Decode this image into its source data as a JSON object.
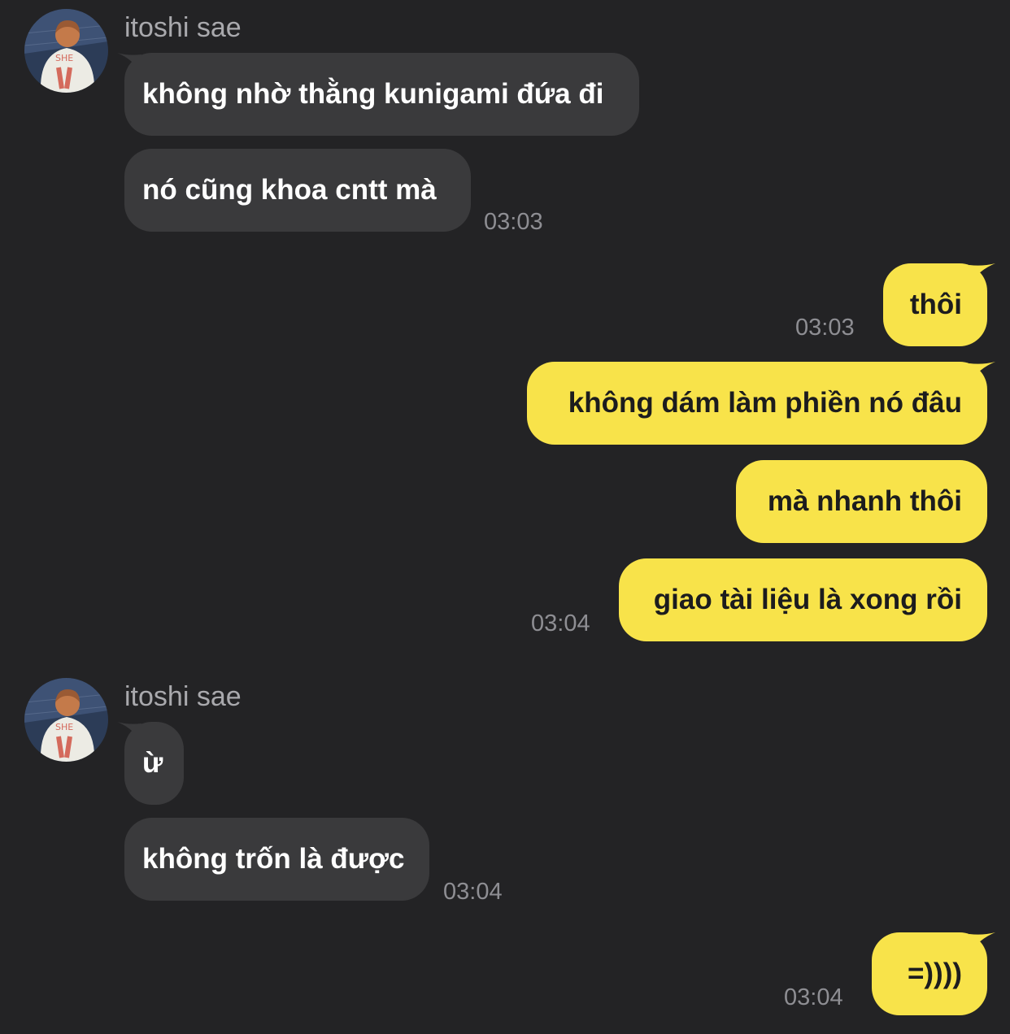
{
  "messages": [
    {
      "type": "sender",
      "name": "itoshi sae"
    },
    {
      "type": "in",
      "text": "không nhờ thằng kunigami đứa đi"
    },
    {
      "type": "in",
      "text": "nó cũng khoa cntt mà",
      "time": "03:03"
    },
    {
      "type": "out",
      "text": "thôi",
      "time": "03:03"
    },
    {
      "type": "out",
      "text": "không dám làm phiền nó đâu"
    },
    {
      "type": "out",
      "text": "mà nhanh thôi"
    },
    {
      "type": "out",
      "text": "giao tài liệu là xong rồi",
      "time": "03:04"
    },
    {
      "type": "sender",
      "name": "itoshi sae"
    },
    {
      "type": "in",
      "text": "ừ"
    },
    {
      "type": "in",
      "text": "không trốn là được",
      "time": "03:04"
    },
    {
      "type": "out",
      "text": "=))))",
      "time": "03:04"
    }
  ],
  "colors": {
    "background": "#232325",
    "incoming_bubble": "#3a3a3c",
    "outgoing_bubble": "#f8e34a",
    "sender_name": "#a9a9ad",
    "timestamp": "#8e8e93"
  }
}
